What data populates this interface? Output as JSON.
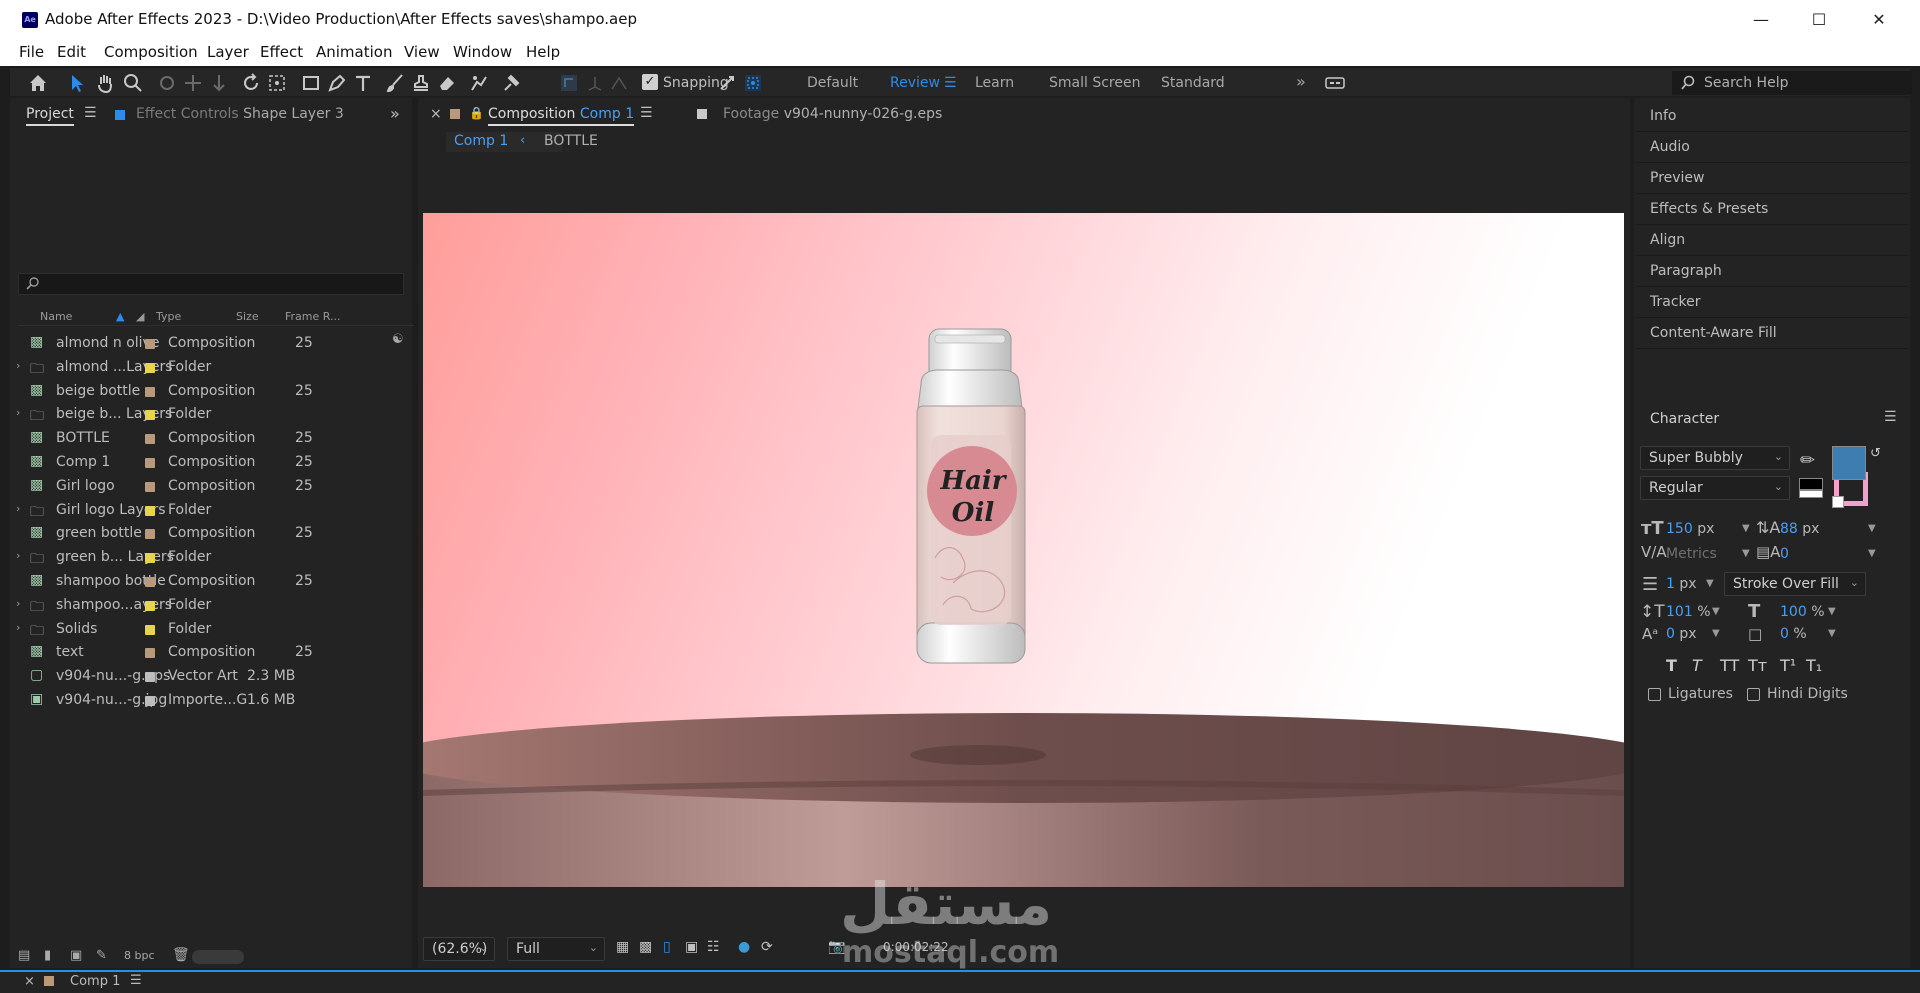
{
  "window": {
    "title": "Adobe After Effects 2023 - D:\\Video Production\\After Effects saves\\shampo.aep",
    "app_icon_text": "Ae",
    "controls": [
      "minimize",
      "maximize",
      "close"
    ]
  },
  "menu": [
    "File",
    "Edit",
    "Composition",
    "Layer",
    "Effect",
    "Animation",
    "View",
    "Window",
    "Help"
  ],
  "toolbar": {
    "snapping_label": "Snapping",
    "snapping_checked": true,
    "workspaces": [
      "Default",
      "Review",
      "Learn",
      "Small Screen",
      "Standard"
    ],
    "active_workspace": "Review",
    "search_placeholder": "Search Help"
  },
  "project_panel": {
    "tab_label": "Project",
    "effect_controls_label": "Effect Controls",
    "effect_controls_layer": "Shape Layer 3",
    "search_placeholder": "",
    "columns": [
      "Name",
      "Type",
      "Size",
      "Frame R..."
    ],
    "items": [
      {
        "name": "almond n olive",
        "type": "Composition",
        "size": "",
        "frame_rate": "25",
        "icon": "composition",
        "label_color": "#b89a7a",
        "expandable": false
      },
      {
        "name": "almond ...Layers",
        "type": "Folder",
        "size": "",
        "frame_rate": "",
        "icon": "folder",
        "label_color": "#e8d34a",
        "expandable": true
      },
      {
        "name": "beige bottle",
        "type": "Composition",
        "size": "",
        "frame_rate": "25",
        "icon": "composition",
        "label_color": "#b89a7a",
        "expandable": false
      },
      {
        "name": "beige b... Layers",
        "type": "Folder",
        "size": "",
        "frame_rate": "",
        "icon": "folder",
        "label_color": "#e8d34a",
        "expandable": true
      },
      {
        "name": "BOTTLE",
        "type": "Composition",
        "size": "",
        "frame_rate": "25",
        "icon": "composition",
        "label_color": "#b89a7a",
        "expandable": false
      },
      {
        "name": "Comp 1",
        "type": "Composition",
        "size": "",
        "frame_rate": "25",
        "icon": "composition",
        "label_color": "#b89a7a",
        "expandable": false
      },
      {
        "name": "Girl logo",
        "type": "Composition",
        "size": "",
        "frame_rate": "25",
        "icon": "composition",
        "label_color": "#b89a7a",
        "expandable": false
      },
      {
        "name": "Girl logo Layers",
        "type": "Folder",
        "size": "",
        "frame_rate": "",
        "icon": "folder",
        "label_color": "#e8d34a",
        "expandable": true
      },
      {
        "name": "green bottle",
        "type": "Composition",
        "size": "",
        "frame_rate": "25",
        "icon": "composition",
        "label_color": "#b89a7a",
        "expandable": false
      },
      {
        "name": "green b... Layers",
        "type": "Folder",
        "size": "",
        "frame_rate": "",
        "icon": "folder",
        "label_color": "#e8d34a",
        "expandable": true
      },
      {
        "name": "shampoo bottle",
        "type": "Composition",
        "size": "",
        "frame_rate": "25",
        "icon": "composition",
        "label_color": "#b89a7a",
        "expandable": false
      },
      {
        "name": "shampoo...ayers",
        "type": "Folder",
        "size": "",
        "frame_rate": "",
        "icon": "folder",
        "label_color": "#e8d34a",
        "expandable": true
      },
      {
        "name": "Solids",
        "type": "Folder",
        "size": "",
        "frame_rate": "",
        "icon": "folder",
        "label_color": "#e8d34a",
        "expandable": true
      },
      {
        "name": "text",
        "type": "Composition",
        "size": "",
        "frame_rate": "25",
        "icon": "composition",
        "label_color": "#b89a7a",
        "expandable": false
      },
      {
        "name": "v904-nu...-g.eps",
        "type": "Vector Art",
        "size": "2.3 MB",
        "frame_rate": "",
        "icon": "vector",
        "label_color": "#bdbdbd",
        "expandable": false
      },
      {
        "name": "v904-nu...-g.jpg",
        "type": "Importe...G",
        "size": "1.6 MB",
        "frame_rate": "",
        "icon": "image",
        "label_color": "#bdbdbd",
        "expandable": false
      }
    ],
    "bit_depth": "8 bpc"
  },
  "composition_panel": {
    "tab_prefix": "Composition",
    "tab_comp": "Comp 1",
    "footage_tab_prefix": "Footage",
    "footage_tab_name": "v904-nunny-026-g.eps",
    "breadcrumb": [
      "Comp 1",
      "BOTTLE"
    ],
    "bottle_label": [
      "Hair",
      "Oil"
    ],
    "zoom": "(62.6%)",
    "resolution": "Full",
    "timecode": "0:00:02:22"
  },
  "right_panel": {
    "items": [
      "Info",
      "Audio",
      "Preview",
      "Effects & Presets",
      "Align",
      "Paragraph",
      "Tracker",
      "Content-Aware Fill"
    ],
    "character": {
      "title": "Character",
      "font": "Super Bubbly",
      "style": "Regular",
      "fill_color": "#3d7db0",
      "stroke_color": "#f2a0cc",
      "font_size": "150",
      "leading": "88",
      "kerning": "Metrics",
      "tracking": "0",
      "stroke_width": "1",
      "stroke_mode": "Stroke Over Fill",
      "vertical_scale": "101",
      "horizontal_scale": "100",
      "baseline_shift": "0",
      "tsume": "0",
      "unit_px": "px",
      "unit_pct": "%",
      "ligatures_label": "Ligatures",
      "hindi_digits_label": "Hindi Digits"
    }
  },
  "bottom": {
    "comp_tab": "Comp 1"
  },
  "watermark": {
    "arabic": "مستقل",
    "latin": "mostaql.com"
  }
}
